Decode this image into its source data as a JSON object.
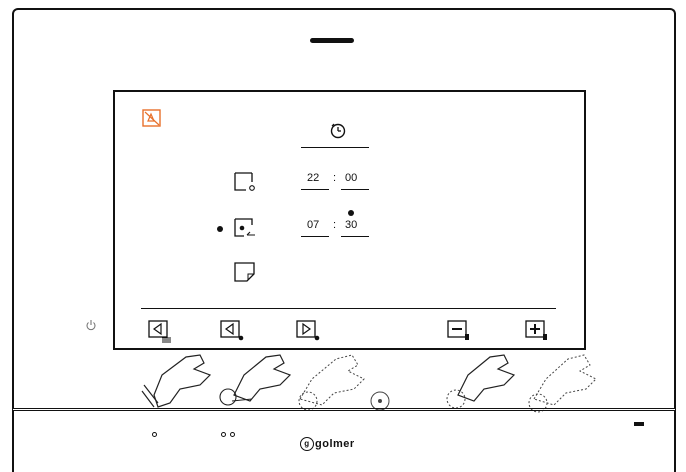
{
  "screen": {
    "clock_icon": "clock-icon",
    "mute_icon": "mute-icon",
    "row1": {
      "hour": "22",
      "sep": ":",
      "minute": "00"
    },
    "row2": {
      "hour": "07",
      "sep": ":",
      "minute": "30"
    },
    "selected_row": 2,
    "accent_color": "#e8702a"
  },
  "softkeys": [
    "back-list-key",
    "left-arrow-key",
    "right-arrow-key",
    "minus-key",
    "plus-key"
  ],
  "brand": "golmer",
  "brand_initial": "g"
}
